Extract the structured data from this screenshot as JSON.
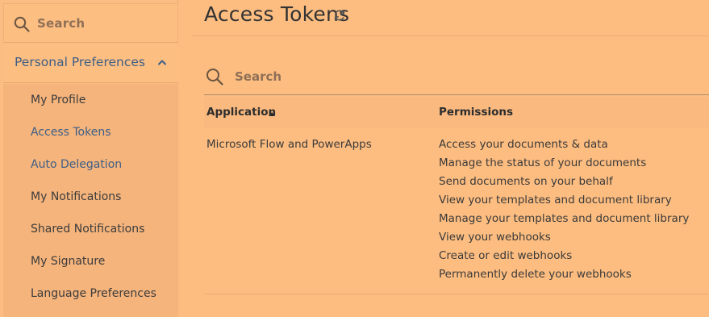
{
  "sidebar": {
    "search_placeholder": "Search",
    "section_label": "Personal Preferences",
    "items": [
      {
        "label": "My Profile",
        "active": false
      },
      {
        "label": "Access Tokens",
        "active": true
      },
      {
        "label": "Auto Delegation",
        "active": true
      },
      {
        "label": "My Notifications",
        "active": false
      },
      {
        "label": "Shared Notifications",
        "active": false
      },
      {
        "label": "My Signature",
        "active": false
      },
      {
        "label": "Language Preferences",
        "active": false
      }
    ]
  },
  "main": {
    "title": "Access Tokens",
    "search_placeholder": "Search",
    "table": {
      "columns": [
        "Application",
        "Permissions"
      ],
      "sort": {
        "column": "Application",
        "direction": "ascending"
      },
      "rows": [
        {
          "application": "Microsoft Flow and PowerApps",
          "permissions": [
            "Access your documents & data",
            "Manage the status of your documents",
            "Send documents on your behalf",
            "View your templates and document library",
            "Manage your templates and document library",
            "View your webhooks",
            "Create or edit webhooks",
            "Permanently delete your webhooks"
          ]
        }
      ]
    }
  },
  "colors": {
    "background": "#fdbd80",
    "link_blue": "#3d5f86",
    "text": "#3a3a3a",
    "placeholder": "#8f7056"
  },
  "icons": {
    "search": "search-icon",
    "chevron": "chevron-up-icon",
    "refresh": "refresh-icon",
    "sort": "sort-ascending-icon"
  }
}
